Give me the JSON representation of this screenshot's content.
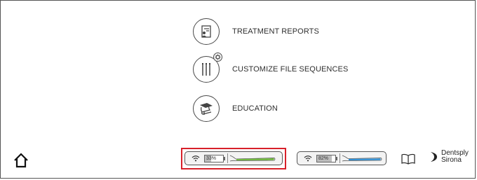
{
  "menu": {
    "items": [
      {
        "label": "TREATMENT REPORTS",
        "icon": "report-document-icon"
      },
      {
        "label": "CUSTOMIZE FILE SEQUENCES",
        "icon": "files-sequence-icon"
      },
      {
        "label": "EDUCATION",
        "icon": "graduation-book-icon"
      }
    ]
  },
  "footer": {
    "home_icon": "home-icon",
    "devices": [
      {
        "battery_label": "33%",
        "battery_level": 0.33,
        "accent_color": "#6fba3a",
        "highlighted": true
      },
      {
        "battery_label": "82%",
        "battery_level": 0.82,
        "accent_color": "#2d8fd6",
        "highlighted": false
      }
    ],
    "manual_icon": "open-book-icon",
    "brand": {
      "line1": "Dentsply",
      "line2": "Sirona"
    }
  },
  "colors": {
    "highlight": "#d8202a",
    "green": "#6fba3a",
    "blue": "#2d8fd6"
  }
}
